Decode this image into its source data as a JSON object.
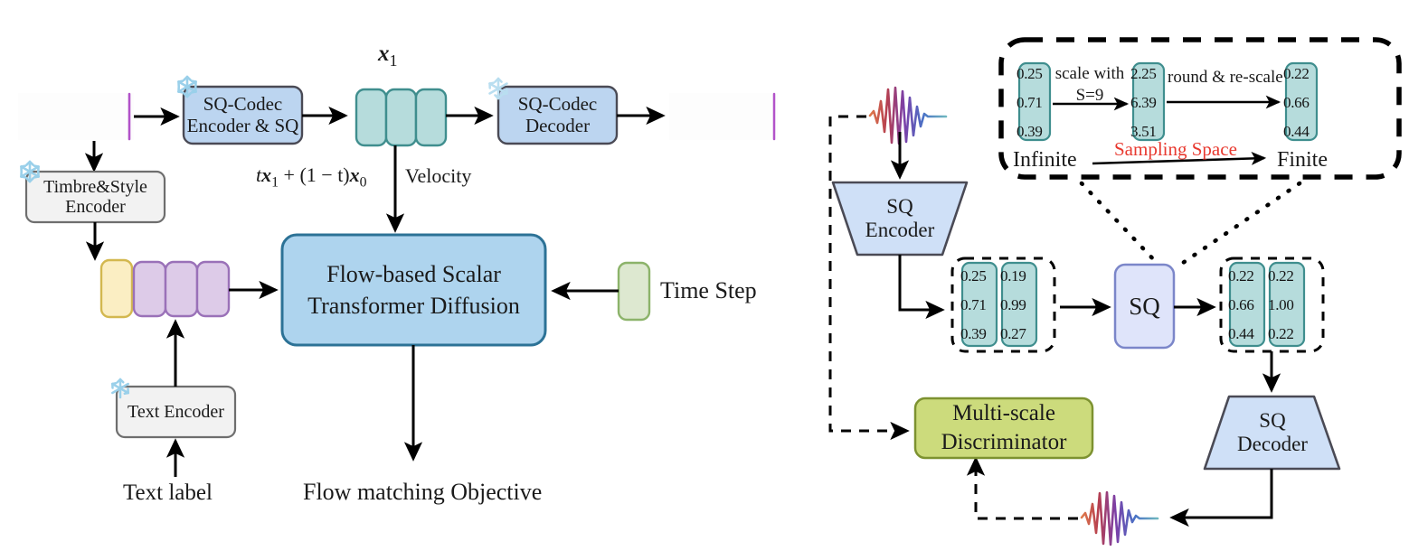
{
  "figure": {
    "title": "Flow-based Scalar Transformer Diffusion and SQ-Codec architecture",
    "colors": {
      "codec_block_fill": "#bcd5f0",
      "codec_block_stroke": "#4a4a55",
      "frozen_block_fill": "#f2f2f2",
      "frozen_block_stroke": "#6e6e6e",
      "latent_teal_fill": "#b6dcdc",
      "latent_teal_stroke": "#3f8e8e",
      "prompt_yellow_fill": "#fbeec3",
      "prompt_yellow_stroke": "#d3b84f",
      "prompt_purple_fill": "#ddcbe8",
      "prompt_purple_stroke": "#9a71b8",
      "timestep_green_fill": "#dde8d0",
      "timestep_green_stroke": "#8cb36a",
      "main_block_fill": "#aed4ee",
      "main_block_stroke": "#2c7296",
      "sq_block_fill": "#dfe4fa",
      "sq_block_stroke": "#7b86c9",
      "discriminator_fill": "#ccdb7c",
      "discriminator_stroke": "#7d9230",
      "trapezoid_fill": "#cfe0f7",
      "trapezoid_stroke": "#4a4a55",
      "arrow": "#000000",
      "sampling_space_text": "#e8392f"
    }
  },
  "left_panel": {
    "blocks": {
      "sq_codec_encoder": {
        "line1": "SQ-Codec",
        "line2": "Encoder & SQ",
        "frozen": true
      },
      "sq_codec_decoder": {
        "line1": "SQ-Codec",
        "line2": "Decoder",
        "frozen": true
      },
      "timbre_style_encoder": {
        "line1": "Timbre&Style",
        "line2": "Encoder",
        "frozen": true
      },
      "text_encoder": {
        "line1": "Text Encoder",
        "frozen": true
      },
      "main_model": {
        "line1": "Flow-based Scalar",
        "line2": "Transformer Diffusion"
      },
      "time_step": {
        "label": "Time Step"
      }
    },
    "labels": {
      "x1_symbol": "x",
      "x1_sub": "1",
      "interpolation_prefix": "t",
      "interpolation_x1": "x",
      "interpolation_x1_sub": "1",
      "interpolation_mid": " + (1 − t)",
      "interpolation_x0": "x",
      "interpolation_x0_sub": "0",
      "velocity": "Velocity",
      "text_label": "Text label",
      "objective": "Flow matching  Objective"
    },
    "icons": {
      "snowflake": "snowflake-icon",
      "waveform_input": "audio-waveform-icon",
      "waveform_output": "audio-waveform-icon"
    },
    "latent_token_count": 3,
    "prompt_yellow_count": 1,
    "prompt_purple_count": 3
  },
  "right_panel": {
    "blocks": {
      "sq_encoder": {
        "line1": "SQ",
        "line2": "Encoder"
      },
      "sq_decoder": {
        "line1": "SQ",
        "line2": "Decoder"
      },
      "sq": {
        "label": "SQ"
      },
      "discriminator": {
        "line1": "Multi-scale",
        "line2": "Discriminator"
      }
    },
    "callout": {
      "vector_in": [
        "0.25",
        "0.71",
        "0.39"
      ],
      "op1_line1": "scale with",
      "op1_line2": "S=9",
      "vector_scaled": [
        "2.25",
        "6.39",
        "3.51"
      ],
      "op2": "round & re-scale",
      "vector_out": [
        "0.22",
        "0.66",
        "0.44"
      ],
      "left_word": "Infinite",
      "center_word": "Sampling Space",
      "right_word": "Finite"
    },
    "pre_sq_vectors": [
      [
        "0.25",
        "0.71",
        "0.39"
      ],
      [
        "0.19",
        "0.99",
        "0.27"
      ]
    ],
    "post_sq_vectors": [
      [
        "0.22",
        "0.66",
        "0.44"
      ],
      [
        "0.22",
        "1.00",
        "0.22"
      ]
    ],
    "icons": {
      "waveform_input": "audio-waveform-icon",
      "waveform_recon": "audio-waveform-icon"
    }
  }
}
